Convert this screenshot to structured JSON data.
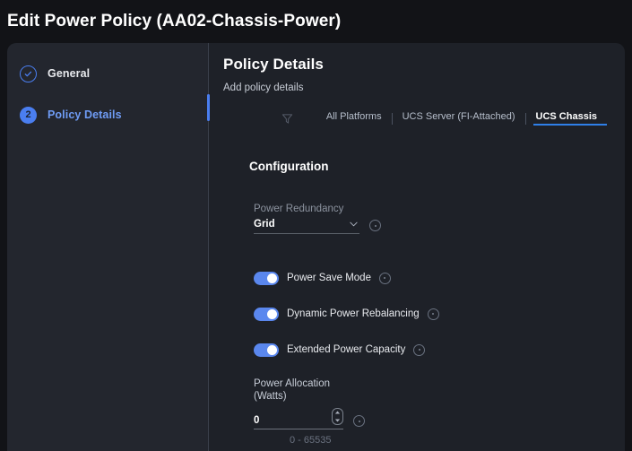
{
  "window": {
    "title": "Edit Power Policy (AA02-Chassis-Power)"
  },
  "sidebar": {
    "steps": [
      {
        "label": "General",
        "badge": "",
        "state": "completed",
        "icon": "check-circle-icon"
      },
      {
        "label": "Policy Details",
        "badge": "2",
        "state": "active",
        "icon": "step-number-badge"
      }
    ]
  },
  "content": {
    "section_title": "Policy Details",
    "section_subtitle": "Add policy details",
    "filter_icon": "funnel-filter-icon",
    "tabs": [
      {
        "label": "All Platforms",
        "active": false
      },
      {
        "label": "UCS Server (FI-Attached)",
        "active": false
      },
      {
        "label": "UCS Chassis",
        "active": true
      }
    ],
    "configuration": {
      "heading": "Configuration",
      "power_redundancy": {
        "label": "Power Redundancy",
        "value": "Grid",
        "chevron_icon": "chevron-down-icon",
        "info_icon": "info-icon"
      },
      "toggles": [
        {
          "label": "Power Save Mode",
          "on": true,
          "info_icon": "info-icon"
        },
        {
          "label": "Dynamic Power Rebalancing",
          "on": true,
          "info_icon": "info-icon"
        },
        {
          "label": "Extended Power Capacity",
          "on": true,
          "info_icon": "info-icon"
        }
      ],
      "power_allocation": {
        "label_line1": "Power Allocation",
        "label_line2": "(Watts)",
        "value": "0",
        "hint": "0 - 65535",
        "stepper_icon": "spinner-stepper-icon",
        "info_icon": "info-icon"
      }
    }
  },
  "colors": {
    "accent_blue": "#4a7ef0",
    "tab_underline": "#2f7fe8",
    "toggle_on": "#5a87ee",
    "panel_bg": "#1e2128",
    "sidebar_bg": "#23262e",
    "window_bg": "#121317"
  }
}
